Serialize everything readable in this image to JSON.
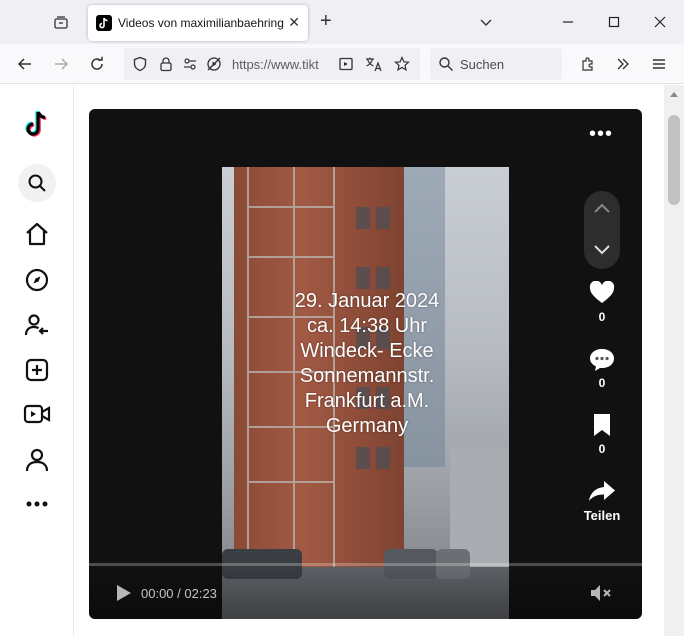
{
  "browser": {
    "tab": {
      "title": "Videos von maximilianbaehring",
      "close_glyph": "✕"
    },
    "newtab_glyph": "+",
    "url": "https://www.tikt",
    "search_placeholder": "Suchen"
  },
  "sidebar": {
    "items": [
      {
        "name": "tiktok-logo"
      },
      {
        "name": "search-icon"
      },
      {
        "name": "home-icon"
      },
      {
        "name": "explore-icon"
      },
      {
        "name": "following-icon"
      },
      {
        "name": "upload-icon"
      },
      {
        "name": "live-icon"
      },
      {
        "name": "profile-icon"
      },
      {
        "name": "more-icon"
      }
    ]
  },
  "video": {
    "caption_lines": [
      "29. Januar 2024",
      "ca. 14:38 Uhr",
      "Windeck- Ecke",
      "Sonnemannstr.",
      "Frankfurt a.M.",
      "Germany"
    ],
    "more_glyph": "•••",
    "likes": "0",
    "comments": "0",
    "saves": "0",
    "share_label": "Teilen",
    "time": "00:00 / 02:23",
    "progress_fraction": 0.0
  },
  "colors": {
    "tab_bar": "#f0f0f4",
    "nav_bar": "#f9f9fb",
    "video_bg": "#111111",
    "accent_pink": "#fe2c55",
    "accent_cyan": "#25f4ee"
  }
}
